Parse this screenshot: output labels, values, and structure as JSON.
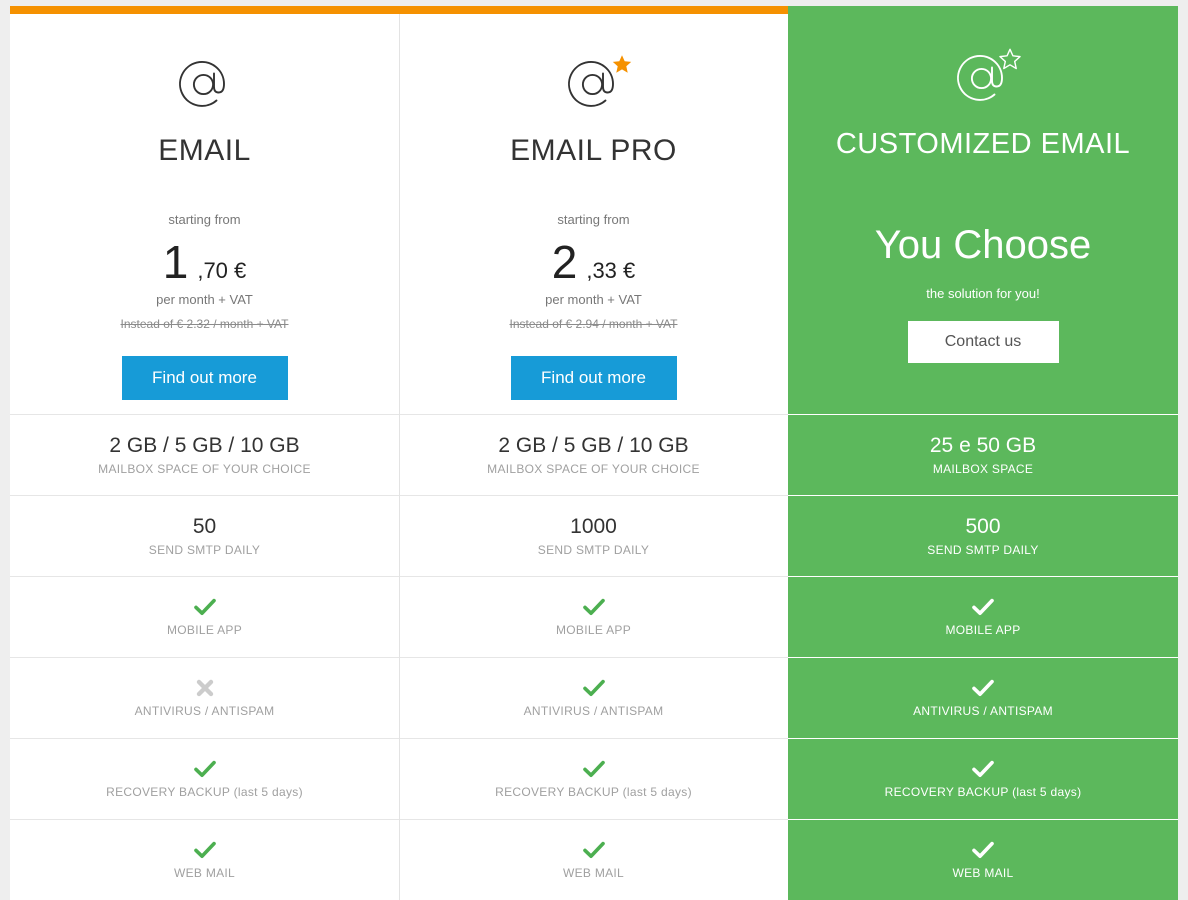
{
  "colors": {
    "accent_orange": "#f59100",
    "featured_green": "#5cb85c",
    "cta_blue": "#179bd7",
    "check_green": "#4caf50",
    "cross_gray": "#cccccc",
    "page_background": "#eeeeee"
  },
  "feature_labels": [
    "MAILBOX SPACE OF YOUR CHOICE",
    "SEND SMTP DAILY",
    "MOBILE APP",
    "ANTIVIRUS / ANTISPAM",
    "RECOVERY BACKUP (last 5 days)",
    "WEB MAIL"
  ],
  "plans": [
    {
      "id": "email",
      "icon": "at-sign-icon",
      "name": "EMAIL",
      "starting_from": "starting from",
      "price_integer": "1",
      "price_decimal": ",70 €",
      "price_period": "per month + VAT",
      "price_old": "Instead of € 2.32 / month + VAT",
      "cta_label": "Find out more",
      "featured": false,
      "has_star": false,
      "features": [
        {
          "value": "2 GB / 5 GB / 10 GB",
          "label": "MAILBOX SPACE OF YOUR CHOICE",
          "type": "text"
        },
        {
          "value": "50",
          "label": "SEND SMTP DAILY",
          "type": "text"
        },
        {
          "value": "check",
          "label": "MOBILE APP",
          "type": "mark"
        },
        {
          "value": "cross",
          "label": "ANTIVIRUS / ANTISPAM",
          "type": "mark"
        },
        {
          "value": "check",
          "label": "RECOVERY BACKUP (last 5 days)",
          "type": "mark"
        },
        {
          "value": "check",
          "label": "WEB MAIL",
          "type": "mark"
        }
      ]
    },
    {
      "id": "email-pro",
      "icon": "at-sign-star-icon",
      "name": "EMAIL PRO",
      "starting_from": "starting from",
      "price_integer": "2",
      "price_decimal": ",33 €",
      "price_period": "per month + VAT",
      "price_old": "Instead of € 2.94 / month + VAT",
      "cta_label": "Find out more",
      "featured": false,
      "has_star": true,
      "features": [
        {
          "value": "2 GB / 5 GB / 10 GB",
          "label": "MAILBOX SPACE OF YOUR CHOICE",
          "type": "text"
        },
        {
          "value": "1000",
          "label": "SEND SMTP DAILY",
          "type": "text"
        },
        {
          "value": "check",
          "label": "MOBILE APP",
          "type": "mark"
        },
        {
          "value": "check",
          "label": "ANTIVIRUS / ANTISPAM",
          "type": "mark"
        },
        {
          "value": "check",
          "label": "RECOVERY BACKUP (last 5 days)",
          "type": "mark"
        },
        {
          "value": "check",
          "label": "WEB MAIL",
          "type": "mark"
        }
      ]
    },
    {
      "id": "customized-email",
      "icon": "at-sign-star-outline-icon",
      "name": "CUSTOMIZED EMAIL",
      "headline": "You Choose",
      "subheadline": "the solution for you!",
      "cta_label": "Contact us",
      "featured": true,
      "has_star": true,
      "features": [
        {
          "value": "25 e 50 GB",
          "label": "MAILBOX SPACE",
          "type": "text"
        },
        {
          "value": "500",
          "label": "SEND SMTP DAILY",
          "type": "text"
        },
        {
          "value": "check",
          "label": "MOBILE APP",
          "type": "mark"
        },
        {
          "value": "check",
          "label": "ANTIVIRUS / ANTISPAM",
          "type": "mark"
        },
        {
          "value": "check",
          "label": "RECOVERY BACKUP (last 5 days)",
          "type": "mark"
        },
        {
          "value": "check",
          "label": "WEB MAIL",
          "type": "mark"
        }
      ]
    }
  ]
}
